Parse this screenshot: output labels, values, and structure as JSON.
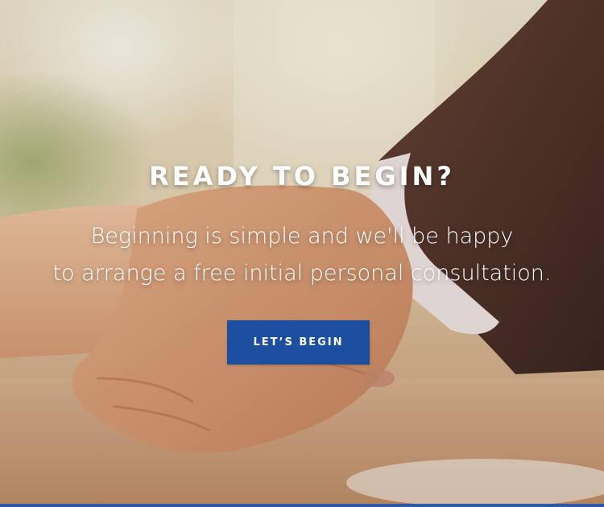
{
  "hero": {
    "headline": "READY TO BEGIN?",
    "subline_1": "Beginning is simple and we'll be happy",
    "subline_2": "to arrange a free initial personal consultation.",
    "cta_label": "LET’S BEGIN"
  },
  "colors": {
    "cta_background": "#1d4fa0",
    "bottom_bar": "#2f58a6",
    "text": "#ffffff"
  }
}
